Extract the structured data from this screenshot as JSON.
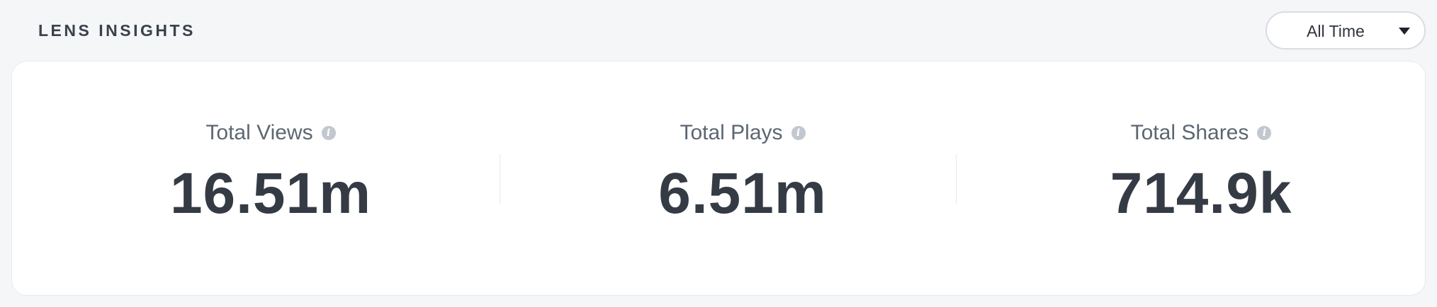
{
  "header": {
    "title": "LENS INSIGHTS",
    "time_filter": {
      "selected": "All Time",
      "icon": "caret-down-icon"
    }
  },
  "metrics": [
    {
      "label": "Total Views",
      "value": "16.51m",
      "icon": "info-icon"
    },
    {
      "label": "Total Plays",
      "value": "6.51m",
      "icon": "info-icon"
    },
    {
      "label": "Total Shares",
      "value": "714.9k",
      "icon": "info-icon"
    }
  ],
  "colors": {
    "page_background": "#f5f6f8",
    "card_background": "#ffffff",
    "text_primary": "#353b44",
    "text_secondary": "#5d6671",
    "info_icon": "#c2c8d0"
  }
}
